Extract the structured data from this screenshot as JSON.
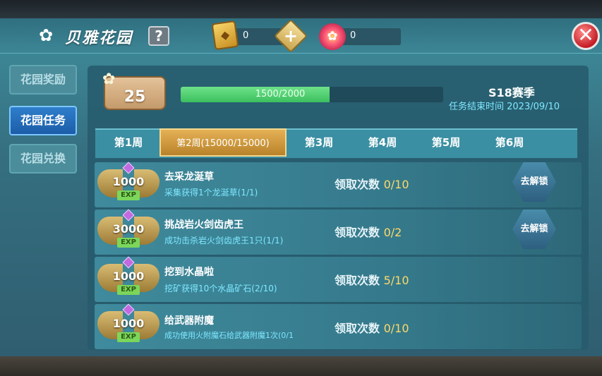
{
  "header": {
    "title": "贝雅花园",
    "help_label": "?",
    "coupon_count": "0",
    "gem_count": "0",
    "close_label": "✕"
  },
  "sidebar": {
    "items": [
      {
        "label": "花园奖励",
        "active": false
      },
      {
        "label": "花园任务",
        "active": true
      },
      {
        "label": "花园兑换",
        "active": false
      }
    ]
  },
  "garden": {
    "level": "25",
    "progress_text": "1500/2000",
    "progress_current": 1500,
    "progress_max": 2000,
    "season": "S18赛季",
    "end_time": "任务结束时间 2023/09/10"
  },
  "tabs": [
    {
      "label": "第1周"
    },
    {
      "label": "第2周(15000/15000)",
      "active": true
    },
    {
      "label": "第3周"
    },
    {
      "label": "第4周"
    },
    {
      "label": "第5周"
    },
    {
      "label": "第6周"
    }
  ],
  "claim_label": "领取次数",
  "exp_tag": "EXP",
  "tasks": [
    {
      "exp": "1000",
      "title": "去采龙涎草",
      "desc": "采集获得1个龙涎草(1/1)",
      "count": "0/10",
      "unlock": "去解锁"
    },
    {
      "exp": "3000",
      "title": "挑战岩火剑齿虎王",
      "desc": "成功击杀岩火剑齿虎王1只(1/1)",
      "count": "0/2",
      "unlock": "去解锁"
    },
    {
      "exp": "1000",
      "title": "挖到水晶啦",
      "desc": "挖矿获得10个水晶矿石(2/10)",
      "count": "5/10",
      "unlock": ""
    },
    {
      "exp": "1000",
      "title": "给武器附魔",
      "desc": "成功使用火附魔石给武器附魔1次(0/1",
      "count": "0/10",
      "unlock": ""
    }
  ],
  "colors": {
    "accent_gold": "#e5b155",
    "progress_green": "#3bbf5e",
    "highlight_cyan": "#7fe8ff",
    "active_blue": "#1c5da8"
  }
}
